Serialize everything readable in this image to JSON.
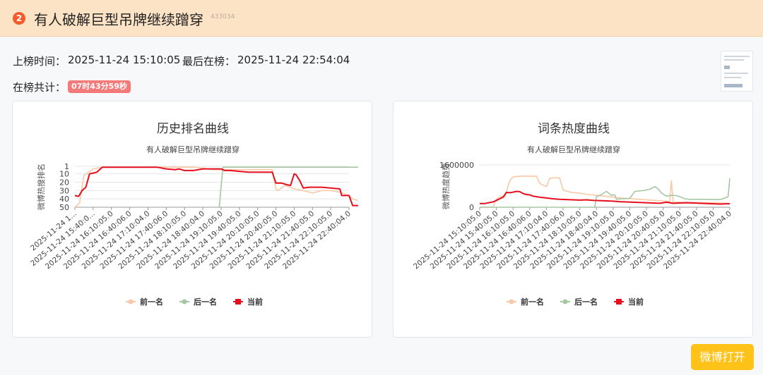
{
  "header": {
    "rank": "2",
    "title": "有人破解巨型吊牌继续蹭穿",
    "id": "433034"
  },
  "meta": {
    "on_time_label": "上榜时间：",
    "on_time": "2025-11-24 15:10:05",
    "last_label": "最后在榜：",
    "last_time": "2025-11-24 22:54:04",
    "total_label": "在榜共计：",
    "duration": "07时43分59秒"
  },
  "button": {
    "open_label": "微博打开"
  },
  "colors": {
    "prev": "#f8c9a8",
    "next": "#a7c7a3",
    "current": "#e60f1f",
    "button": "#ffc218",
    "header_bg": "#fde3c6"
  },
  "chart_data": [
    {
      "type": "line",
      "title": "历史排名曲线",
      "subtitle": "有人破解巨型吊牌继续蹭穿",
      "xlabel": "",
      "ylabel": "微博热搜排名",
      "y_inverse": true,
      "ylim": [
        1,
        50
      ],
      "y_ticks": [
        "1",
        "10",
        "20",
        "30",
        "40",
        "50"
      ],
      "x_ticks": [
        "2025-11-24 1...",
        "2025-11-24 15:40:0...",
        "2025-11-24 16:10:05.0",
        "2025-11-24 16:40:06.0",
        "2025-11-24 17:10:04.0",
        "2025-11-24 17:40:06.0",
        "2025-11-24 18:10:05.0",
        "2025-11-24 18:40:04.0",
        "2025-11-24 19:10:05.0",
        "2025-11-24 19:40:05.0",
        "2025-11-24 20:10:05.0",
        "2025-11-24 20:40:05.0",
        "2025-11-24 21:10:05.0",
        "2025-11-24 21:40:05.0",
        "2025-11-24 22:10:05.0",
        "2025-11-24 22:40:04.0"
      ],
      "legend": [
        "前一名",
        "后一名",
        "当前"
      ],
      "legend_position": "bottom",
      "grid": true,
      "series": [
        {
          "name": "前一名",
          "color": "#f8c9a8",
          "points": [
            [
              0,
              50
            ],
            [
              0.25,
              45
            ],
            [
              0.5,
              12
            ],
            [
              1,
              4
            ],
            [
              1.5,
              2
            ],
            [
              2,
              2
            ],
            [
              2.5,
              2
            ],
            [
              3,
              2
            ],
            [
              3.5,
              2
            ],
            [
              4,
              2
            ],
            [
              4.5,
              2
            ],
            [
              5,
              2
            ],
            [
              5.5,
              2
            ],
            [
              6,
              2
            ],
            [
              6.5,
              2
            ],
            [
              7,
              3
            ],
            [
              7.5,
              5
            ],
            [
              8,
              5
            ],
            [
              8.5,
              5
            ],
            [
              9,
              5
            ],
            [
              9.5,
              5
            ],
            [
              10,
              5
            ],
            [
              10.5,
              5
            ],
            [
              10.8,
              5
            ],
            [
              11,
              28
            ],
            [
              11.1,
              30
            ],
            [
              11.5,
              24
            ],
            [
              12,
              28
            ],
            [
              12.5,
              30
            ],
            [
              13,
              33
            ],
            [
              13.5,
              30
            ],
            [
              14,
              30
            ],
            [
              14.5,
              32
            ],
            [
              15,
              36
            ],
            [
              15.2,
              40
            ],
            [
              15.5,
              42
            ]
          ]
        },
        {
          "name": "后一名",
          "color": "#a7c7a3",
          "points": [
            [
              7.9,
              50
            ],
            [
              8.1,
              2
            ],
            [
              9,
              2
            ],
            [
              10,
              2
            ],
            [
              11,
              2
            ],
            [
              12,
              2
            ],
            [
              13,
              2
            ],
            [
              14,
              2
            ],
            [
              15,
              2
            ],
            [
              15.5,
              2
            ]
          ]
        },
        {
          "name": "当前",
          "color": "#e60f1f",
          "points": [
            [
              0,
              36
            ],
            [
              0.2,
              37
            ],
            [
              0.4,
              30
            ],
            [
              0.6,
              26
            ],
            [
              0.8,
              10
            ],
            [
              1,
              9
            ],
            [
              1.2,
              8
            ],
            [
              1.4,
              4
            ],
            [
              1.5,
              2
            ],
            [
              2,
              2
            ],
            [
              2.5,
              2
            ],
            [
              3,
              2
            ],
            [
              3.5,
              2
            ],
            [
              4,
              2
            ],
            [
              4.5,
              2
            ],
            [
              5,
              4
            ],
            [
              5.5,
              5
            ],
            [
              5.7,
              4
            ],
            [
              6,
              6
            ],
            [
              6.5,
              6
            ],
            [
              7,
              4
            ],
            [
              7.5,
              4
            ],
            [
              8,
              4
            ],
            [
              8.2,
              6
            ],
            [
              8.5,
              6
            ],
            [
              9,
              7
            ],
            [
              9.5,
              8
            ],
            [
              10,
              8
            ],
            [
              10.5,
              8
            ],
            [
              10.8,
              8
            ],
            [
              11,
              21
            ],
            [
              11.3,
              21
            ],
            [
              11.6,
              23
            ],
            [
              11.8,
              24
            ],
            [
              12,
              10
            ],
            [
              12.1,
              11
            ],
            [
              12.3,
              18
            ],
            [
              12.5,
              27
            ],
            [
              12.8,
              26
            ],
            [
              13,
              26
            ],
            [
              13.5,
              26
            ],
            [
              14,
              27
            ],
            [
              14.5,
              28
            ],
            [
              14.6,
              36
            ],
            [
              15,
              36
            ],
            [
              15.2,
              48
            ],
            [
              15.5,
              48
            ]
          ]
        }
      ]
    },
    {
      "type": "line",
      "title": "词条热度曲线",
      "subtitle": "有人破解巨型吊牌继续蹭穿",
      "xlabel": "",
      "ylabel": "微博热度趋势",
      "ylim": [
        0,
        1600000
      ],
      "y_ticks": [
        "0",
        "1600000"
      ],
      "x_ticks": [
        "2025-11-24 15:10:05.0",
        "2025-11-24 15:40:05.0",
        "2025-11-24 16:10:05.0",
        "2025-11-24 16:40:06.0",
        "2025-11-24 17:10:04.0",
        "2025-11-24 17:40:06.0",
        "2025-11-24 18:10:05.0",
        "2025-11-24 18:40:04.0",
        "2025-11-24 19:10:05.0",
        "2025-11-24 19:40:05.0",
        "2025-11-24 20:10:05.0",
        "2025-11-24 20:40:05.0",
        "2025-11-24 21:10:05.0",
        "2025-11-24 21:40:05.0",
        "2025-11-24 22:10:05.0",
        "2025-11-24 22:40:04.0"
      ],
      "legend": [
        "前一名",
        "后一名",
        "当前"
      ],
      "legend_position": "bottom",
      "grid": true,
      "series": [
        {
          "name": "前一名",
          "color": "#f8c9a8",
          "points": [
            [
              0,
              0
            ],
            [
              0.8,
              0
            ],
            [
              1,
              300000
            ],
            [
              1.3,
              420000
            ],
            [
              1.5,
              380000
            ],
            [
              1.8,
              1000000
            ],
            [
              2,
              1150000
            ],
            [
              2.5,
              1180000
            ],
            [
              3,
              1170000
            ],
            [
              3.4,
              1180000
            ],
            [
              3.6,
              900000
            ],
            [
              4,
              780000
            ],
            [
              4.2,
              1100000
            ],
            [
              4.6,
              1120000
            ],
            [
              4.8,
              1100000
            ],
            [
              5,
              650000
            ],
            [
              5.5,
              560000
            ],
            [
              6,
              530000
            ],
            [
              6.5,
              480000
            ],
            [
              7,
              450000
            ],
            [
              7.5,
              420000
            ],
            [
              8,
              380000
            ],
            [
              8.5,
              350000
            ],
            [
              9,
              330000
            ],
            [
              9.5,
              300000
            ],
            [
              10,
              280000
            ],
            [
              10.5,
              260000
            ],
            [
              11,
              240000
            ],
            [
              11.4,
              220000
            ],
            [
              11.5,
              1000000
            ],
            [
              11.6,
              200000
            ],
            [
              12,
              190000
            ],
            [
              13,
              180000
            ],
            [
              14,
              170000
            ],
            [
              14.5,
              160000
            ],
            [
              15,
              150000
            ]
          ]
        },
        {
          "name": "后一名",
          "color": "#a7c7a3",
          "points": [
            [
              0,
              0
            ],
            [
              5,
              0
            ],
            [
              6,
              0
            ],
            [
              6.9,
              0
            ],
            [
              7,
              400000
            ],
            [
              7.3,
              480000
            ],
            [
              7.6,
              600000
            ],
            [
              7.9,
              450000
            ],
            [
              8.1,
              470000
            ],
            [
              8.2,
              300000
            ],
            [
              8.5,
              320000
            ],
            [
              9,
              330000
            ],
            [
              9.3,
              600000
            ],
            [
              9.6,
              620000
            ],
            [
              9.9,
              640000
            ],
            [
              10.2,
              680000
            ],
            [
              10.5,
              780000
            ],
            [
              10.7,
              700000
            ],
            [
              10.9,
              540000
            ],
            [
              11.2,
              420000
            ],
            [
              11.5,
              450000
            ],
            [
              11.8,
              440000
            ],
            [
              12,
              400000
            ],
            [
              12.3,
              320000
            ],
            [
              12.6,
              300000
            ],
            [
              13,
              300000
            ],
            [
              13.5,
              300000
            ],
            [
              14,
              290000
            ],
            [
              14.5,
              300000
            ],
            [
              14.9,
              400000
            ],
            [
              15,
              1100000
            ]
          ]
        },
        {
          "name": "当前",
          "color": "#e60f1f",
          "points": [
            [
              0,
              140000
            ],
            [
              0.3,
              140000
            ],
            [
              0.6,
              180000
            ],
            [
              0.8,
              200000
            ],
            [
              1,
              260000
            ],
            [
              1.2,
              320000
            ],
            [
              1.4,
              380000
            ],
            [
              1.6,
              560000
            ],
            [
              1.8,
              550000
            ],
            [
              2,
              570000
            ],
            [
              2.2,
              600000
            ],
            [
              2.4,
              590000
            ],
            [
              2.6,
              520000
            ],
            [
              2.8,
              480000
            ],
            [
              3,
              470000
            ],
            [
              3.2,
              420000
            ],
            [
              3.6,
              380000
            ],
            [
              4,
              350000
            ],
            [
              4.4,
              320000
            ],
            [
              4.8,
              300000
            ],
            [
              5.2,
              290000
            ],
            [
              5.6,
              280000
            ],
            [
              6,
              270000
            ],
            [
              6.4,
              280000
            ],
            [
              6.8,
              260000
            ],
            [
              7.2,
              250000
            ],
            [
              7.6,
              240000
            ],
            [
              8,
              230000
            ],
            [
              8.4,
              210000
            ],
            [
              8.8,
              200000
            ],
            [
              9.2,
              190000
            ],
            [
              9.6,
              180000
            ],
            [
              10,
              170000
            ],
            [
              10.4,
              160000
            ],
            [
              10.8,
              150000
            ],
            [
              11.2,
              190000
            ],
            [
              11.6,
              150000
            ],
            [
              12,
              160000
            ],
            [
              12.4,
              170000
            ],
            [
              12.8,
              160000
            ],
            [
              13.2,
              150000
            ],
            [
              13.6,
              140000
            ],
            [
              14,
              130000
            ],
            [
              14.4,
              120000
            ],
            [
              14.8,
              130000
            ],
            [
              15,
              130000
            ]
          ]
        }
      ]
    }
  ]
}
